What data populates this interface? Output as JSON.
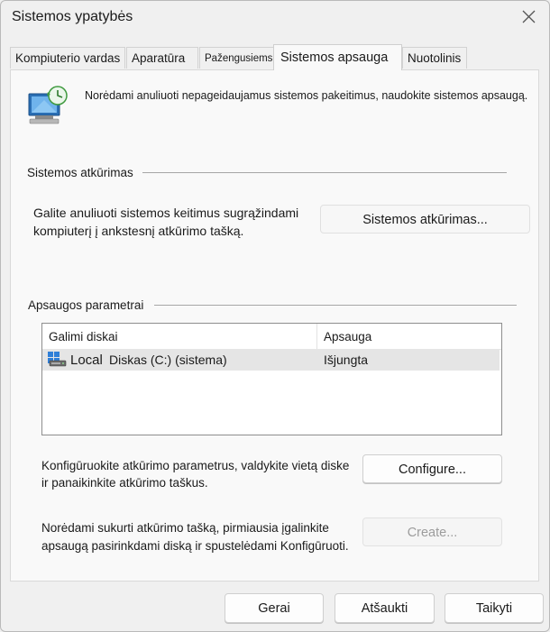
{
  "window": {
    "title": "Sistemos ypatybės"
  },
  "tabs": [
    {
      "label": "Kompiuterio vardas",
      "active": false
    },
    {
      "label": "Aparatūra",
      "active": false
    },
    {
      "label": "Pažengusiems",
      "active": false
    },
    {
      "label": "Sistemos apsauga",
      "active": true
    },
    {
      "label": "Nuotolinis",
      "active": false
    }
  ],
  "intro": {
    "text": "Norėdami anuliuoti nepageidaujamus sistemos pakeitimus, naudokite sistemos apsaugą."
  },
  "restore": {
    "group_title": "Sistemos atkūrimas",
    "text_line1": "Galite anuliuoti sistemos keitimus sugrąžindami",
    "text_line2": "kompiuterį į ankstesnį atkūrimo tašką.",
    "button_label": "Sistemos atkūrimas..."
  },
  "protection": {
    "group_title": "Apsaugos parametrai",
    "columns": [
      "Galimi diskai",
      "Apsauga"
    ],
    "rows": [
      {
        "drive_prefix": "Local",
        "drive_name": "Diskas (C:) (sistema)",
        "protection": "Išjungta",
        "icon": "drive-icon"
      }
    ],
    "configure_text_line1": "Konfigūruokite atkūrimo parametrus, valdykite vietą diske",
    "configure_text_line2": "ir panaikinkite atkūrimo taškus.",
    "configure_button": "Configure...",
    "create_text_line1": "Norėdami sukurti atkūrimo tašką, pirmiausia įgalinkite",
    "create_text_line2": "apsaugą pasirinkdami diską ir spustelėdami Konfigūruoti.",
    "create_button": "Create...",
    "create_enabled": false
  },
  "footer": {
    "ok": "Gerai",
    "cancel": "Atšaukti",
    "apply": "Taikyti"
  },
  "colors": {
    "window_bg": "#f0f0f0",
    "panel_bg": "#f9f9f9",
    "row_selected": "#e5e5e5",
    "disabled_text": "#9c9c9c"
  }
}
